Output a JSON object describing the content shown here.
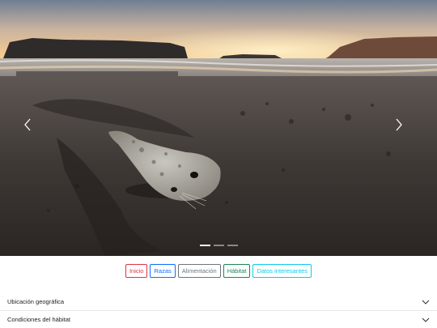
{
  "carousel": {
    "image_alt": "Cría de foca en la playa al atardecer",
    "slide_count": 3,
    "active_slide": 1
  },
  "nav": {
    "buttons": [
      {
        "label": "Inicio",
        "color": "#dc3545"
      },
      {
        "label": "Razas",
        "color": "#0d6efd"
      },
      {
        "label": "Alimentación",
        "color": "#6c757d"
      },
      {
        "label": "Hábitat",
        "color": "#198754"
      },
      {
        "label": "Datos interesantes",
        "color": "#0dcaf0"
      }
    ]
  },
  "accordion": {
    "items": [
      {
        "label": "Ubicación geográfica"
      },
      {
        "label": "Condiciones del hábitat"
      }
    ]
  }
}
